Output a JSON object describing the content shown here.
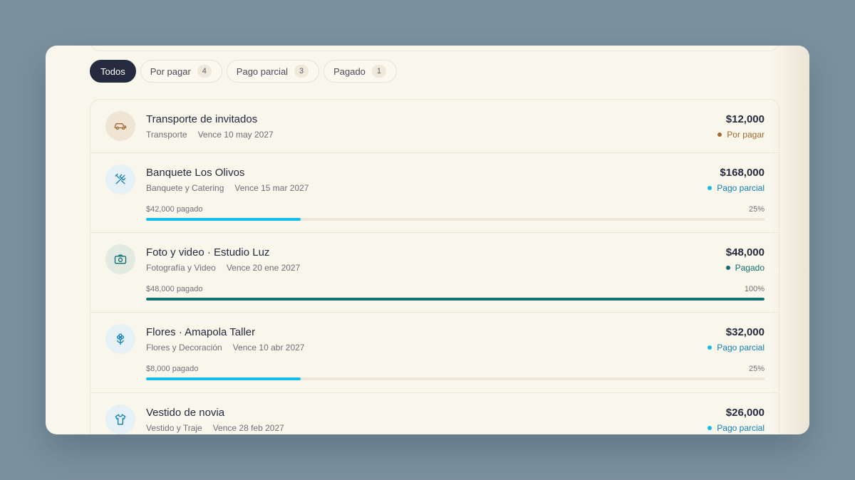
{
  "colors": {
    "pending": "#a4692e",
    "partial": "#0e7fb4",
    "partial_bar": "#12bdf0",
    "paid": "#0f6e70",
    "paid_bar": "#137073"
  },
  "tabs": [
    {
      "label": "Todos",
      "count": null,
      "active": true
    },
    {
      "label": "Por pagar",
      "count": "4"
    },
    {
      "label": "Pago parcial",
      "count": "3"
    },
    {
      "label": "Pagado",
      "count": "1"
    }
  ],
  "items": [
    {
      "title": "Transporte de invitados",
      "category": "Transporte",
      "due": "Vence 10 may 2027",
      "amount": "$12,000",
      "status": "Por pagar",
      "status_kind": "pending",
      "icon": "car-icon"
    },
    {
      "title": "Banquete Los Olivos",
      "category": "Banquete y Catering",
      "due": "Vence 15 mar 2027",
      "amount": "$168,000",
      "status": "Pago parcial",
      "status_kind": "partial",
      "icon": "utensils-icon",
      "paid_text": "$42,000 pagado",
      "percent_text": "25%",
      "progress": 0.25
    },
    {
      "title": "Foto y video · Estudio Luz",
      "category": "Fotografía y Video",
      "due": "Vence 20 ene 2027",
      "amount": "$48,000",
      "status": "Pagado",
      "status_kind": "paid",
      "icon": "camera-icon",
      "paid_text": "$48,000 pagado",
      "percent_text": "100%",
      "progress": 1.0
    },
    {
      "title": "Flores · Amapola Taller",
      "category": "Flores y Decoración",
      "due": "Vence 10 abr 2027",
      "amount": "$32,000",
      "status": "Pago parcial",
      "status_kind": "partial",
      "icon": "flower-icon",
      "paid_text": "$8,000 pagado",
      "percent_text": "25%",
      "progress": 0.25
    },
    {
      "title": "Vestido de novia",
      "category": "Vestido y Traje",
      "due": "Vence 28 feb 2027",
      "amount": "$26,000",
      "status": "Pago parcial",
      "status_kind": "partial",
      "icon": "shirt-icon"
    }
  ]
}
